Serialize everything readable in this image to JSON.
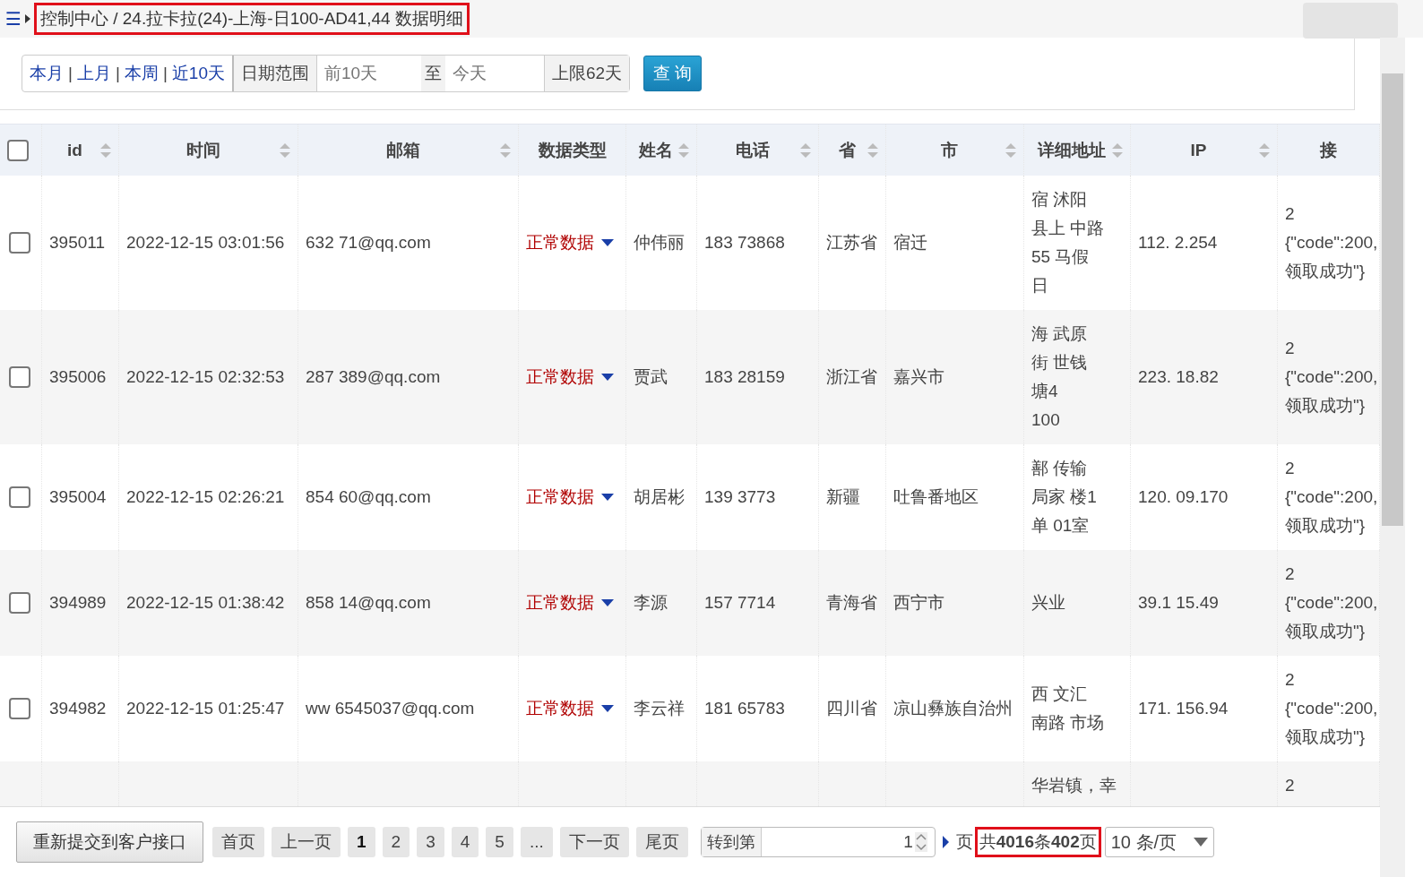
{
  "breadcrumb": {
    "menu_icon": "☰",
    "path": "控制中心 / 24.拉卡拉(24)-上海-日100-AD41,44 数据明细"
  },
  "filter": {
    "quick_ranges": [
      "本月",
      "上月",
      "本周",
      "近10天"
    ],
    "separators": [
      "|",
      "|",
      "|"
    ],
    "date_label": "日期范围",
    "start": {
      "placeholder": "前10天"
    },
    "to_label": "至",
    "end": {
      "placeholder": "今天"
    },
    "limit": "上限62天",
    "query_button": "查 询"
  },
  "table": {
    "select_all": {
      "checked": false
    },
    "columns": [
      {
        "label": "id",
        "sortable": true
      },
      {
        "label": "时间",
        "sortable": true
      },
      {
        "label": "邮箱",
        "sortable": true
      },
      {
        "label": "数据类型",
        "sortable": false
      },
      {
        "label": "姓名",
        "sortable": true
      },
      {
        "label": "电话",
        "sortable": true
      },
      {
        "label": "省",
        "sortable": true
      },
      {
        "label": "市",
        "sortable": true
      },
      {
        "label": "详细地址",
        "sortable": true
      },
      {
        "label": "IP",
        "sortable": true
      },
      {
        "label": "接",
        "sortable": false
      }
    ],
    "rows": [
      {
        "checked": false,
        "id": "395011",
        "time": "2022-12-15 03:01:56",
        "email": "632 71@qq.com",
        "data_type": "正常数据",
        "name": "仲伟丽",
        "phone": "183 73868",
        "province": "江苏省",
        "city": "宿迁",
        "address": [
          "宿 沭阳",
          "县上 中路",
          "55 马假",
          "日"
        ],
        "ip": "112. 2.254",
        "response": [
          "2",
          "{\"code\":200,",
          "领取成功\"}"
        ]
      },
      {
        "checked": false,
        "id": "395006",
        "time": "2022-12-15 02:32:53",
        "email": "287 389@qq.com",
        "data_type": "正常数据",
        "name": "贾武",
        "phone": "183 28159",
        "province": "浙江省",
        "city": "嘉兴市",
        "address": [
          "海 武原",
          "街 世钱",
          "塘4",
          "100"
        ],
        "ip": "223. 18.82",
        "response": [
          "2",
          "{\"code\":200,",
          "领取成功\"}"
        ]
      },
      {
        "checked": false,
        "id": "395004",
        "time": "2022-12-15 02:26:21",
        "email": "854 60@qq.com",
        "data_type": "正常数据",
        "name": "胡居彬",
        "phone": "139 3773",
        "province": "新疆",
        "city": "吐鲁番地区",
        "address": [
          "鄯 传输",
          "局家 楼1",
          "单 01室"
        ],
        "ip": "120. 09.170",
        "response": [
          "2",
          "{\"code\":200,",
          "领取成功\"}"
        ]
      },
      {
        "checked": false,
        "id": "394989",
        "time": "2022-12-15 01:38:42",
        "email": "858 14@qq.com",
        "data_type": "正常数据",
        "name": "李源",
        "phone": "157 7714",
        "province": "青海省",
        "city": "西宁市",
        "address": [
          "兴业"
        ],
        "ip": "39.1 15.49",
        "response": [
          "2",
          "{\"code\":200,",
          "领取成功\"}"
        ]
      },
      {
        "checked": false,
        "id": "394982",
        "time": "2022-12-15 01:25:47",
        "email": "ww 6545037@qq.com",
        "data_type": "正常数据",
        "name": "李云祥",
        "phone": "181 65783",
        "province": "四川省",
        "city": "凉山彝族自治州",
        "address": [
          "西 文汇",
          "南路 市场"
        ],
        "ip": "171. 156.94",
        "response": [
          "2",
          "{\"code\":200,",
          "领取成功\"}"
        ]
      },
      {
        "address": [
          "华岩镇，幸"
        ],
        "response": [
          "2"
        ]
      }
    ]
  },
  "footer": {
    "resubmit_button": "重新提交到客户接口",
    "pages": [
      {
        "label": "首页",
        "selected": false
      },
      {
        "label": "上一页",
        "selected": false
      },
      {
        "label": "1",
        "selected": true
      },
      {
        "label": "2",
        "selected": false
      },
      {
        "label": "3",
        "selected": false
      },
      {
        "label": "4",
        "selected": false
      },
      {
        "label": "5",
        "selected": false
      },
      {
        "label": "...",
        "selected": false
      },
      {
        "label": "下一页",
        "selected": false
      },
      {
        "label": "尾页",
        "selected": false
      }
    ],
    "goto_label": "转到第",
    "goto_value": "1",
    "page_unit": "页",
    "summary": "共**4016**条**402**页",
    "page_size": "10 条/页"
  }
}
